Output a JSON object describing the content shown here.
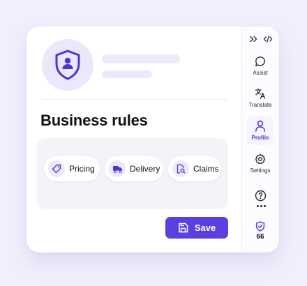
{
  "page": {
    "title": "Business rules",
    "rules": [
      {
        "label": "Pricing",
        "icon": "tag-icon"
      },
      {
        "label": "Delivery",
        "icon": "truck-icon"
      },
      {
        "label": "Claims",
        "icon": "document-search-icon"
      }
    ],
    "save_label": "Save"
  },
  "sidebar": {
    "top_icons": [
      "expand-icon",
      "code-icon"
    ],
    "items": [
      {
        "label": "Assist",
        "icon": "chat-bubble-icon"
      },
      {
        "label": "Translate",
        "icon": "translate-icon"
      },
      {
        "label": "Profile",
        "icon": "user-icon",
        "active": true
      },
      {
        "label": "Settings",
        "icon": "gear-icon"
      }
    ],
    "help_icon": "help-icon",
    "more_icon": "more-dots-icon",
    "score": {
      "value": "66",
      "icon": "shield-check-icon"
    }
  },
  "colors": {
    "accent": "#5b3fe0",
    "background": "#f1effc",
    "icon_bg": "#ebe8fb"
  }
}
